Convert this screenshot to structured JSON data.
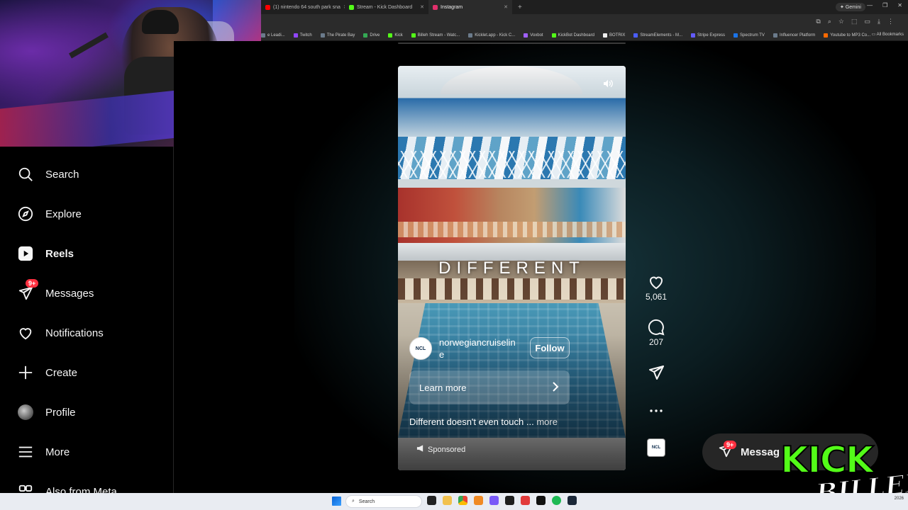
{
  "browser": {
    "tabs": [
      {
        "label": "(1) nintendo 64 south park sna",
        "color": "#ff0000"
      },
      {
        "label": "Stream - Kick Dashboard",
        "color": "#53fc18"
      },
      {
        "label": "Instagram",
        "color": "#e1306c"
      }
    ],
    "new_tab": "+",
    "gemini_label": "Gemini",
    "bookmarks": [
      "e Leadi...",
      "Twitch",
      "The Pirate Bay",
      "Drive",
      "Kick",
      "Billeh Stream - Watc...",
      "Kicklet.app - Kick C...",
      "Voxbot",
      "KickBot Dashboard",
      "BOTRIX",
      "StreamElements - M...",
      "Stripe Express",
      "Spectrum TV",
      "Influencer Platform",
      "Youtube to MP3 Co..."
    ],
    "all_bookmarks": "All Bookmarks"
  },
  "sidebar": {
    "items": [
      {
        "label": "Search",
        "icon": "search-icon"
      },
      {
        "label": "Explore",
        "icon": "compass-icon"
      },
      {
        "label": "Reels",
        "icon": "reels-icon"
      },
      {
        "label": "Messages",
        "icon": "messenger-icon",
        "badge": "9+"
      },
      {
        "label": "Notifications",
        "icon": "heart-icon"
      },
      {
        "label": "Create",
        "icon": "plus-icon"
      },
      {
        "label": "Profile",
        "icon": "avatar"
      },
      {
        "label": "More",
        "icon": "menu-icon"
      },
      {
        "label": "Also from Meta",
        "icon": "meta-icon"
      }
    ]
  },
  "reel": {
    "overlay_text": "DIFFERENT",
    "account": "norwegiancruiseline",
    "account_logo": "NCL",
    "follow_label": "Follow",
    "cta_label": "Learn more",
    "caption": "Different doesn't even touch ...",
    "caption_more": "more",
    "sponsored_label": "Sponsored"
  },
  "actions": {
    "likes": "5,061",
    "comments": "207"
  },
  "messages_button": {
    "label": "Messag",
    "badge": "9+"
  },
  "overlay_logo": {
    "word": "KICK",
    "sub": "BILLEH"
  },
  "taskbar": {
    "search_placeholder": "Search",
    "year": "2026"
  },
  "colors": {
    "accent_red": "#ff3040",
    "kick_green": "#53fc18"
  }
}
